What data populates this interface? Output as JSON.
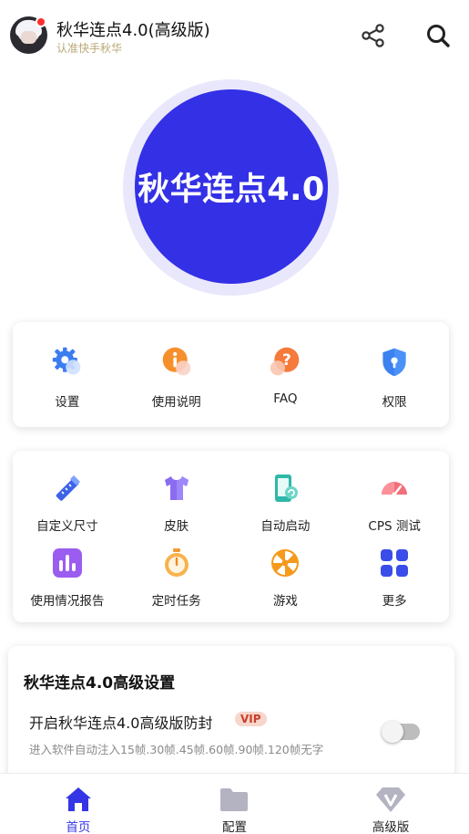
{
  "header": {
    "title": "秋华连点4.0(高级版)",
    "subtitle": "认准快手秋华"
  },
  "hero": {
    "label": "秋华连点4.0",
    "color": "#3330e6"
  },
  "quick_menu": [
    {
      "label": "设置",
      "icon": "gear-icon"
    },
    {
      "label": "使用说明",
      "icon": "info-icon"
    },
    {
      "label": "FAQ",
      "icon": "question-icon"
    },
    {
      "label": "权限",
      "icon": "shield-lock-icon"
    }
  ],
  "tools": [
    {
      "label": "自定义尺寸",
      "icon": "ruler-pencil-icon"
    },
    {
      "label": "皮肤",
      "icon": "shirt-icon"
    },
    {
      "label": "自动启动",
      "icon": "phone-auto-icon"
    },
    {
      "label": "CPS 测试",
      "icon": "speedometer-icon"
    },
    {
      "label": "使用情况报告",
      "icon": "bar-chart-icon"
    },
    {
      "label": "定时任务",
      "icon": "stopwatch-icon"
    },
    {
      "label": "游戏",
      "icon": "game-wheel-icon"
    },
    {
      "label": "更多",
      "icon": "grid-more-icon"
    }
  ],
  "advanced": {
    "title": "秋华连点4.0高级设置",
    "toggle_label": "开启秋华连点4.0高级版防封",
    "badge": "VIP",
    "description": "进入软件自动注入15帧.30帧.45帧.60帧.90帧.120帧无字",
    "enabled": false
  },
  "bottom_nav": [
    {
      "label": "首页",
      "icon": "home-icon",
      "active": true
    },
    {
      "label": "配置",
      "icon": "folder-icon",
      "active": false
    },
    {
      "label": "高级版",
      "icon": "diamond-v-icon",
      "active": false
    }
  ],
  "colors": {
    "accent": "#3535e6",
    "badge_bg": "#f7d6cc",
    "badge_text": "#c8412c",
    "subtitle": "#b9a775"
  }
}
